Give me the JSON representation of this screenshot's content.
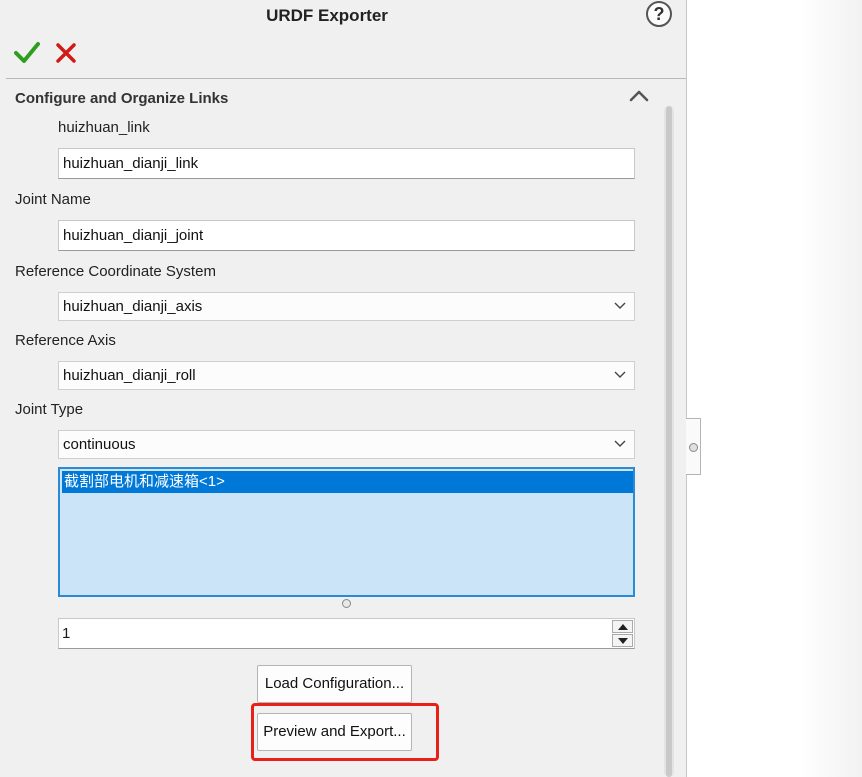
{
  "header": {
    "title": "URDF Exporter",
    "help_glyph": "?"
  },
  "actions": {
    "ok_icon": "checkmark-icon",
    "cancel_icon": "x-icon",
    "ok_color": "#2e9e1e",
    "cancel_color": "#d01c14"
  },
  "section": {
    "title": "Configure and Organize Links",
    "collapse_icon": "chevron-up-icon"
  },
  "form": {
    "link_label": "huizhuan_link",
    "link_name_value": "huizhuan_dianji_link",
    "joint_name_label": "Joint Name",
    "joint_name_value": "huizhuan_dianji_joint",
    "ref_coord_label": "Reference Coordinate System",
    "ref_coord_value": "huizhuan_dianji_axis",
    "ref_axis_label": "Reference Axis",
    "ref_axis_value": "huizhuan_dianji_roll",
    "joint_type_label": "Joint Type",
    "joint_type_value": "continuous",
    "components": [
      "截割部电机和减速箱<1>"
    ],
    "child_count_value": "1"
  },
  "buttons": {
    "load_config": "Load Configuration...",
    "preview_export": "Preview and Export..."
  },
  "highlight_color": "#e8201a"
}
